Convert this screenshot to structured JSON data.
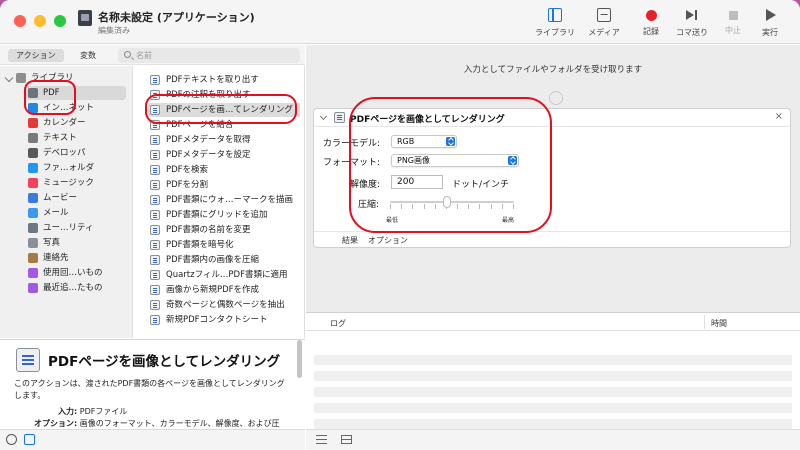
{
  "window": {
    "title": "名称未設定 (アプリケーション)",
    "subtitle": "編集済み"
  },
  "toolbar": {
    "library": "ライブラリ",
    "media": "メディア",
    "record": "記録",
    "step": "コマ送り",
    "stop": "中止",
    "run": "実行"
  },
  "tabs": {
    "actions": "アクション",
    "variables": "変数"
  },
  "search": {
    "placeholder": "名前"
  },
  "categories": [
    {
      "label": "ライブラリ",
      "icon": "library-folder-icon",
      "color": "#8e8e8e"
    },
    {
      "label": "PDF",
      "icon": "pdf-icon",
      "color": "#6b7280"
    },
    {
      "label": "イン…ネット",
      "icon": "internet-icon",
      "color": "#1e88e5"
    },
    {
      "label": "カレンダー",
      "icon": "calendar-icon",
      "color": "#e53935"
    },
    {
      "label": "テキスト",
      "icon": "text-icon",
      "color": "#7a7a7a"
    },
    {
      "label": "デベロッパ",
      "icon": "developer-icon",
      "color": "#5a5a5a"
    },
    {
      "label": "ファ…ォルダ",
      "icon": "finder-icon",
      "color": "#2196f3"
    },
    {
      "label": "ミュージック",
      "icon": "music-icon",
      "color": "#f4405a"
    },
    {
      "label": "ムービー",
      "icon": "movie-icon",
      "color": "#3b7bdc"
    },
    {
      "label": "メール",
      "icon": "mail-icon",
      "color": "#3b9af0"
    },
    {
      "label": "ユー…リティ",
      "icon": "utility-icon",
      "color": "#6d7785"
    },
    {
      "label": "写真",
      "icon": "photos-icon",
      "color": "#8a8f98"
    },
    {
      "label": "連絡先",
      "icon": "contacts-icon",
      "color": "#a37b44"
    },
    {
      "label": "使用回…いもの",
      "icon": "smart-folder-icon",
      "color": "#a259e6"
    },
    {
      "label": "最近追…たもの",
      "icon": "smart-folder-icon",
      "color": "#a259e6"
    }
  ],
  "actions": [
    "PDFテキストを取り出す",
    "PDFの注釈を取り出す",
    "PDFページを画…てレンダリング",
    "PDFページを結合",
    "PDFメタデータを取得",
    "PDFメタデータを設定",
    "PDFを検索",
    "PDFを分割",
    "PDF書類にウォ…ーマークを描画",
    "PDF書類にグリッドを追加",
    "PDF書類の名前を変更",
    "PDF書類を暗号化",
    "PDF書類内の画像を圧縮",
    "Quartzフィル…PDF書類に適用",
    "画像から新規PDFを作成",
    "奇数ページと偶数ページを抽出",
    "新規PDFコンタクトシート"
  ],
  "workflow": {
    "input_caption": "入力としてファイルやフォルダを受け取ります"
  },
  "action_card": {
    "title": "PDFページを画像としてレンダリング",
    "close": "×",
    "color_model_label": "カラーモデル:",
    "color_model_value": "RGB",
    "format_label": "フォーマット:",
    "format_value": "PNG画像",
    "resolution_label": "解像度:",
    "resolution_value": "200",
    "resolution_unit": "ドット/インチ",
    "compression_label": "圧縮:",
    "compression_level": 0.46,
    "min_label": "最低",
    "max_label": "最高",
    "tab_results": "結果",
    "tab_options": "オプション"
  },
  "log": {
    "col_log": "ログ",
    "col_time": "時間"
  },
  "description": {
    "title": "PDFページを画像としてレンダリング",
    "text": "このアクションは、渡されたPDF書類の各ページを画像としてレンダリングします。",
    "input_key": "入力:",
    "input_value": "PDFファイル",
    "option_key": "オプション:",
    "option_value": "画像のフォーマット、カラーモデル、解像度、および圧"
  },
  "colors": {
    "accent": "#1a73e8",
    "highlight": "#e01020",
    "record": "#e8202a"
  }
}
